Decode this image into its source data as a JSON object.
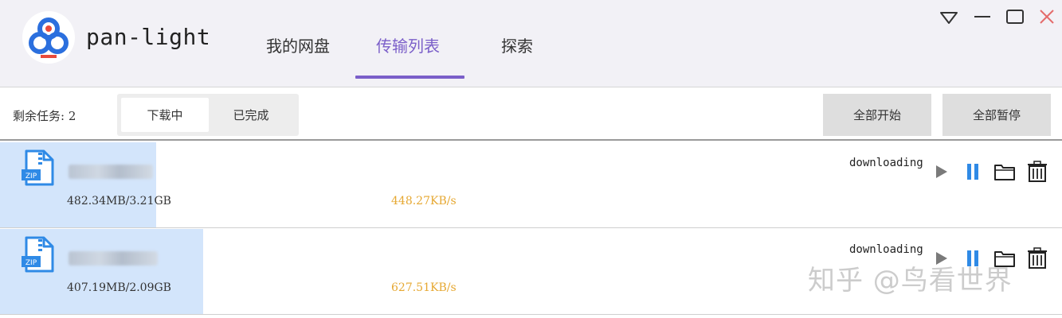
{
  "app": {
    "title": "pan-light"
  },
  "nav": {
    "tabs": [
      {
        "label": "我的网盘",
        "active": false
      },
      {
        "label": "传输列表",
        "active": true
      },
      {
        "label": "探索",
        "active": false
      }
    ]
  },
  "window_controls": [
    "dropdown-icon",
    "minimize-icon",
    "maximize-icon",
    "close-icon"
  ],
  "toolbar": {
    "remaining": "剩余任务: 2",
    "segments": [
      {
        "label": "下载中",
        "active": true
      },
      {
        "label": "已完成",
        "active": false
      }
    ],
    "start_all_label": "全部开始",
    "pause_all_label": "全部暂停"
  },
  "tasks": [
    {
      "file_type_icon": "zip-file-icon",
      "size_progress": "482.34MB/3.21GB",
      "speed": "448.27KB/s",
      "status": "downloading",
      "progress_fraction": 0.147
    },
    {
      "file_type_icon": "zip-file-icon",
      "size_progress": "407.19MB/2.09GB",
      "speed": "627.51KB/s",
      "status": "downloading",
      "progress_fraction": 0.19
    }
  ],
  "row_actions": [
    "play-icon",
    "pause-icon",
    "folder-icon",
    "trash-icon"
  ],
  "watermark": "知乎 @鸟看世界",
  "colors": {
    "accent": "#7b5fc9",
    "progress_fill": "#d3e5fb",
    "speed_text": "#e6a832",
    "icon_blue": "#2f8ae6",
    "logo_blue": "#2b6fde",
    "close_red": "#e46b6b"
  }
}
